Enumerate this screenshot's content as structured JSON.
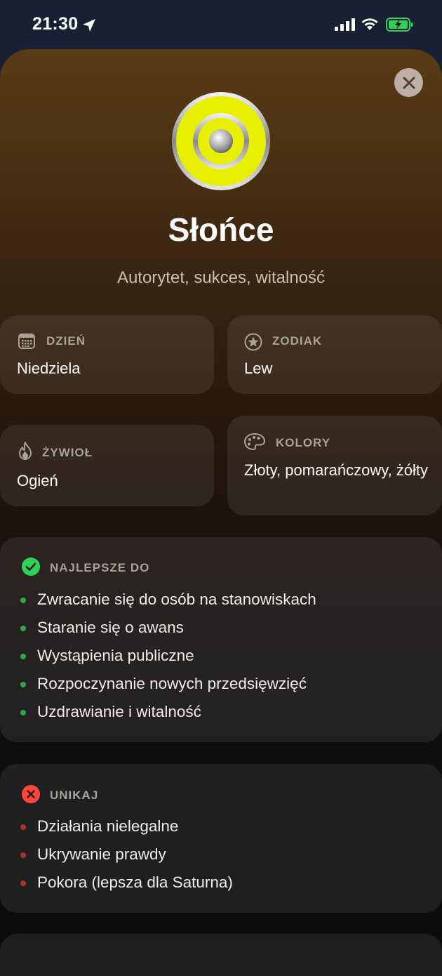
{
  "status_bar": {
    "time": "21:30"
  },
  "planet": {
    "name": "Słońce",
    "subtitle": "Autorytet, sukces, witalność"
  },
  "info_cards": {
    "day": {
      "label": "DZIEŃ",
      "value": "Niedziela"
    },
    "zodiac": {
      "label": "ZODIAK",
      "value": "Lew"
    },
    "element": {
      "label": "ŻYWIOŁ",
      "value": "Ogień"
    },
    "colors": {
      "label": "KOLORY",
      "value": "Złoty, pomarańczowy, żółty"
    }
  },
  "best_for": {
    "label": "NAJLEPSZE DO",
    "items": [
      "Zwracanie się do osób na stanowiskach",
      "Staranie się o awans",
      "Wystąpienia publiczne",
      "Rozpoczynanie nowych przedsięwzięć",
      "Uzdrawianie i witalność"
    ]
  },
  "avoid": {
    "label": "UNIKAJ",
    "items": [
      "Działania nielegalne",
      "Ukrywanie prawdy",
      "Pokora (lepsza dla Saturna)"
    ]
  },
  "colors": {
    "accent_green": "#30d158",
    "accent_red": "#ff453a",
    "sun_yellow": "#e8ef00"
  }
}
